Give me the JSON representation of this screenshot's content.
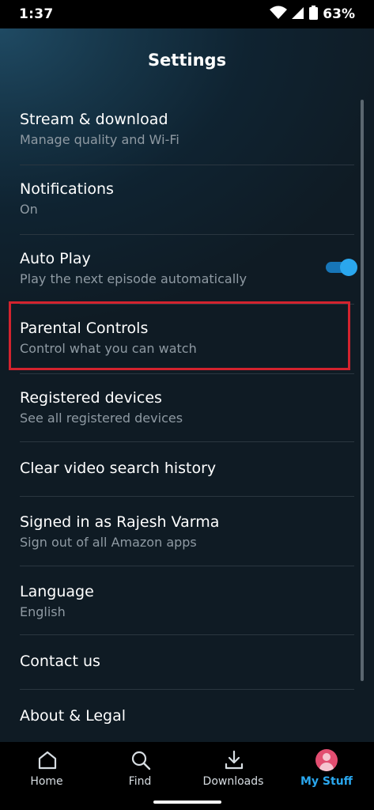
{
  "status_bar": {
    "time": "1:37",
    "battery": "63%"
  },
  "header": {
    "title": "Settings"
  },
  "settings": {
    "stream": {
      "title": "Stream & download",
      "subtitle": "Manage quality and Wi-Fi"
    },
    "notifications": {
      "title": "Notifications",
      "subtitle": "On"
    },
    "autoplay": {
      "title": "Auto Play",
      "subtitle": "Play the next episode automatically",
      "enabled": true
    },
    "parental": {
      "title": "Parental Controls",
      "subtitle": "Control what you can watch"
    },
    "devices": {
      "title": "Registered devices",
      "subtitle": "See all registered devices"
    },
    "clear_history": {
      "title": "Clear video search history"
    },
    "signed_in": {
      "title": "Signed in as Rajesh Varma",
      "subtitle": "Sign out of all Amazon apps"
    },
    "language": {
      "title": "Language",
      "subtitle": "English"
    },
    "contact": {
      "title": "Contact us"
    },
    "about": {
      "title": "About & Legal"
    }
  },
  "nav": {
    "home": "Home",
    "find": "Find",
    "downloads": "Downloads",
    "mystuff": "My Stuff",
    "active": "mystuff"
  },
  "colors": {
    "accent": "#2aa7ee",
    "highlight": "#d3232e"
  }
}
